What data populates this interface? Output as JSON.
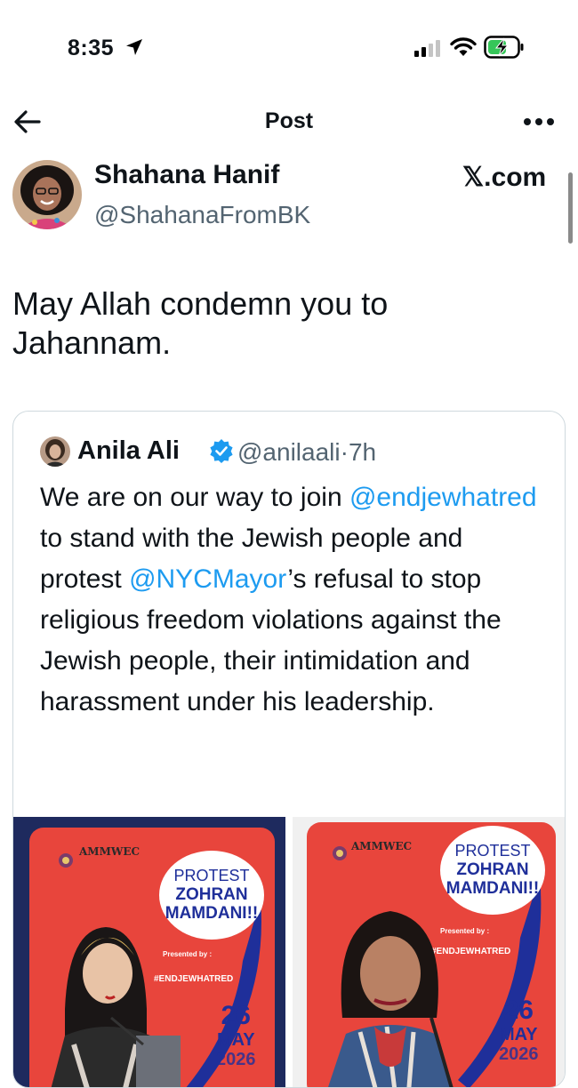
{
  "status_bar": {
    "time": "8:35"
  },
  "nav": {
    "title": "Post"
  },
  "post": {
    "author_name": "Shahana Hanif",
    "author_handle": "@ShahanaFromBK",
    "source": "𝕏.com",
    "text": "May Allah condemn you to Jahannam."
  },
  "quote": {
    "author_name": "Anila Ali",
    "author_handle": "@anilaali",
    "separator": "·",
    "time": "7h",
    "text_segments": [
      {
        "text": "We are on our way to join "
      },
      {
        "text": "@endjewhatred",
        "mention": true
      },
      {
        "text": "  to stand with the Jewish people and protest "
      },
      {
        "text": "@NYCMayor",
        "mention": true
      },
      {
        "text": "’s refusal to stop religious freedom violations against the Jewish people, their intimidation and harassment under his leadership."
      }
    ],
    "posters": [
      {
        "org": "AMMWEC",
        "bubble_line1": "PROTEST",
        "bubble_line2": "ZOHRAN",
        "bubble_line3": "MAMDANI!!",
        "presented": "Presented by :",
        "hashtag": "#ENDJEWHATRED",
        "day": "26",
        "month": "MAY",
        "year": "2026"
      },
      {
        "org": "AMMWEC",
        "bubble_line1": "PROTEST",
        "bubble_line2": "ZOHRAN",
        "bubble_line3": "MAMDANI!!",
        "presented": "Presented by :",
        "hashtag": "#ENDJEWHATRED",
        "day": "26",
        "month": "MAY",
        "year": "2026"
      }
    ]
  },
  "colors": {
    "mention": "#1d9bf0",
    "handle": "#536471",
    "poster_red": "#e8453c",
    "poster_blue": "#1f2f9a"
  },
  "icons": [
    "location-arrow-icon",
    "signal-icon",
    "wifi-icon",
    "battery-charging-icon",
    "back-arrow-icon",
    "more-icon",
    "verified-badge-icon"
  ]
}
